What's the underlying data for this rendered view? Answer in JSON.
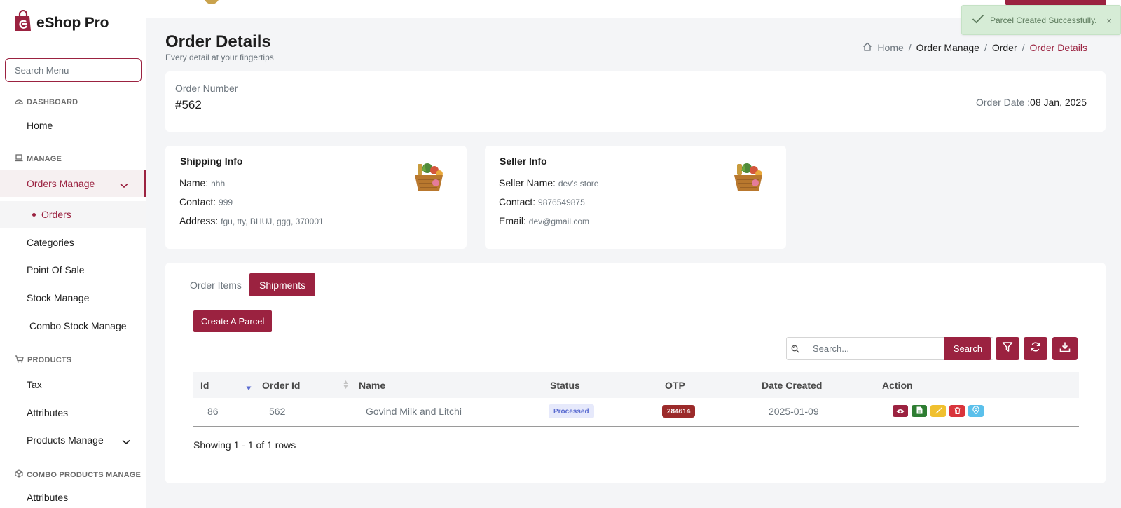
{
  "brand": {
    "name": "eShop Pro"
  },
  "sidebar": {
    "search_placeholder": "Search Menu",
    "sections": {
      "dashboard": "DASHBOARD",
      "manage": "MANAGE",
      "products": "PRODUCTS",
      "combo": "COMBO PRODUCTS MANAGE"
    },
    "items": {
      "home": "Home",
      "orders_manage": "Orders Manage",
      "orders": "Orders",
      "categories": "Categories",
      "pos": "Point Of Sale",
      "stock": "Stock Manage",
      "combo_stock": "Combo Stock Manage",
      "tax": "Tax",
      "attributes": "Attributes",
      "products_manage": "Products Manage",
      "combo_attributes": "Attributes"
    }
  },
  "toast": {
    "message": "Parcel Created Successfully.",
    "close": "×"
  },
  "header": {
    "title": "Order Details",
    "subtitle": "Every detail at your fingertips",
    "breadcrumb": {
      "home": "Home",
      "b1": "Order Manage",
      "b2": "Order",
      "current": "Order Details",
      "sep": "/"
    }
  },
  "order": {
    "number_label": "Order Number",
    "number": "#562",
    "date_label": "Order Date :",
    "date": "08 Jan, 2025"
  },
  "shipping": {
    "title": "Shipping Info",
    "name_label": "Name:",
    "name": "hhh",
    "contact_label": "Contact:",
    "contact": "999",
    "address_label": "Address:",
    "address": "fgu, tty, BHUJ, ggg, 370001"
  },
  "seller": {
    "title": "Seller Info",
    "name_label": "Seller Name:",
    "name": "dev's store",
    "contact_label": "Contact:",
    "contact": "9876549875",
    "email_label": "Email:",
    "email": "dev@gmail.com"
  },
  "tabs": {
    "items": "Order Items",
    "shipments": "Shipments"
  },
  "shipments": {
    "create_parcel": "Create A Parcel",
    "search_placeholder": "Search...",
    "search_button": "Search",
    "columns": [
      "Id",
      "Order Id",
      "Name",
      "Status",
      "OTP",
      "Date Created",
      "Action"
    ],
    "rows": [
      {
        "id": "86",
        "order_id": "562",
        "name": "Govind Milk and Litchi",
        "status": "Processed",
        "otp": "284614",
        "date": "2025-01-09"
      }
    ],
    "footer": "Showing 1 - 1 of 1 rows"
  },
  "colors": {
    "brand": "#9b2240",
    "toast_bg": "#d6ecd6",
    "status_processed": "#e6e9fb",
    "otp_badge": "#9b2a2a",
    "action_view": "#9b2240",
    "action_invoice": "#2e7d32",
    "action_edit": "#f0c02f",
    "action_delete": "#d9343b",
    "action_track": "#5bc0eb"
  }
}
